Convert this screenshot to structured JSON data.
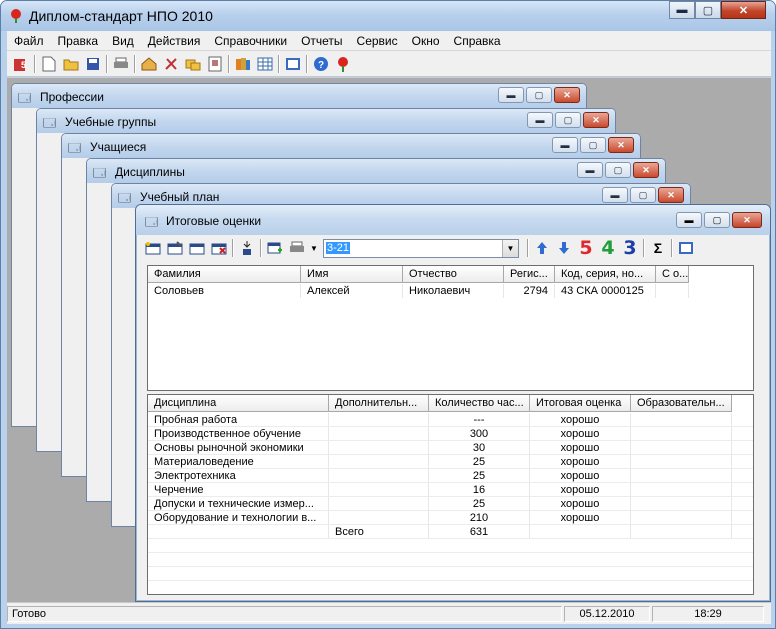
{
  "app": {
    "title": "Диплом-стандарт НПО 2010"
  },
  "menu": [
    {
      "label": "Файл"
    },
    {
      "label": "Правка"
    },
    {
      "label": "Вид"
    },
    {
      "label": "Действия"
    },
    {
      "label": "Справочники"
    },
    {
      "label": "Отчеты"
    },
    {
      "label": "Сервис"
    },
    {
      "label": "Окно"
    },
    {
      "label": "Справка"
    }
  ],
  "windows": {
    "w1": {
      "title": "Профессии"
    },
    "w2": {
      "title": "Учебные группы"
    },
    "w3": {
      "title": "Учащиеся"
    },
    "w4": {
      "title": "Дисциплины"
    },
    "w5": {
      "title": "Учебный план"
    }
  },
  "main": {
    "title": "Итоговые оценки",
    "group_value": "3-21",
    "grades": [
      "5",
      "4",
      "3"
    ],
    "grade_colors": [
      "#e0282e",
      "#1f9e3a",
      "#1f3fa8"
    ],
    "sigma": "Σ",
    "students": {
      "columns": [
        "Фамилия",
        "Имя",
        "Отчество",
        "Регис...",
        "Код, серия, но...",
        "С о..."
      ],
      "rows": [
        [
          "Соловьев",
          "Алексей",
          "Николаевич",
          "2794",
          "43 СКА 0000125",
          ""
        ]
      ]
    },
    "disciplines": {
      "columns": [
        "Дисциплина",
        "Дополнительн...",
        "Количество час...",
        "Итоговая оценка",
        "Образовательн..."
      ],
      "rows": [
        [
          "Пробная работа",
          "",
          "---",
          "хорошо",
          ""
        ],
        [
          "Производственное обучение",
          "",
          "300",
          "хорошо",
          ""
        ],
        [
          "Основы рыночной экономики",
          "",
          "30",
          "хорошо",
          ""
        ],
        [
          "Материаловедение",
          "",
          "25",
          "хорошо",
          ""
        ],
        [
          "Электротехника",
          "",
          "25",
          "хорошо",
          ""
        ],
        [
          "Черчение",
          "",
          "16",
          "хорошо",
          ""
        ],
        [
          "Допуски и технические измер...",
          "",
          "25",
          "хорошо",
          ""
        ],
        [
          "Оборудование и технологии в...",
          "",
          "210",
          "хорошо",
          ""
        ],
        [
          "",
          "Всего",
          "631",
          "",
          ""
        ]
      ]
    }
  },
  "status": {
    "text": "Готово",
    "date": "05.12.2010",
    "time": "18:29"
  }
}
